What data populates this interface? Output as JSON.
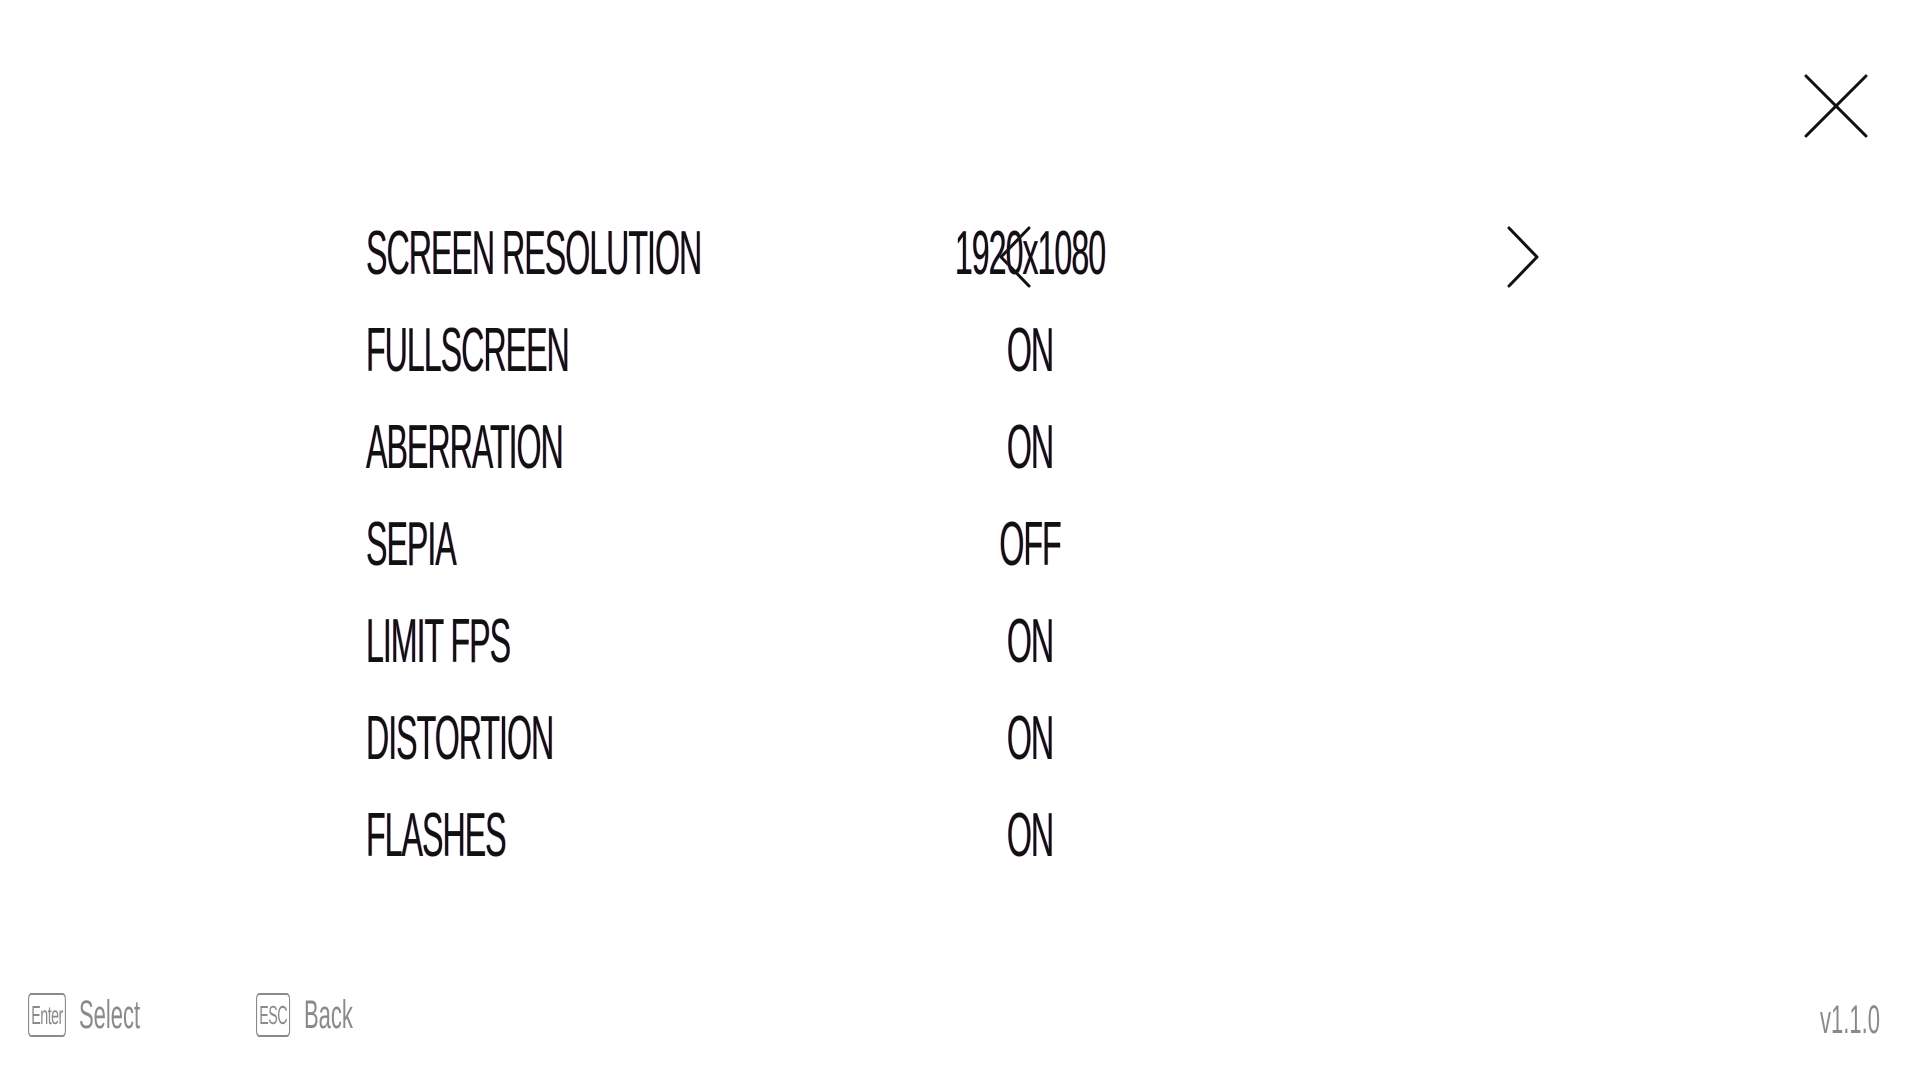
{
  "settings": [
    {
      "label": "SCREEN RESOLUTION",
      "value": "1920x1080",
      "has_arrows": true
    },
    {
      "label": "FULLSCREEN",
      "value": "ON"
    },
    {
      "label": "ABERRATION",
      "value": "ON"
    },
    {
      "label": "SEPIA",
      "value": "OFF"
    },
    {
      "label": "LIMIT FPS",
      "value": "ON"
    },
    {
      "label": "DISTORTION",
      "value": "ON"
    },
    {
      "label": "FLASHES",
      "value": "ON"
    }
  ],
  "footer": {
    "select_key": "Enter",
    "select_label": "Select",
    "back_key": "ESC",
    "back_label": "Back",
    "version": "v1.1.0"
  },
  "icons": {
    "close": "close-icon",
    "prev": "chevron-left-icon",
    "next": "chevron-right-icon"
  },
  "colors": {
    "background": "#ffffff",
    "text": "#111111",
    "muted": "#8a8a8a"
  }
}
